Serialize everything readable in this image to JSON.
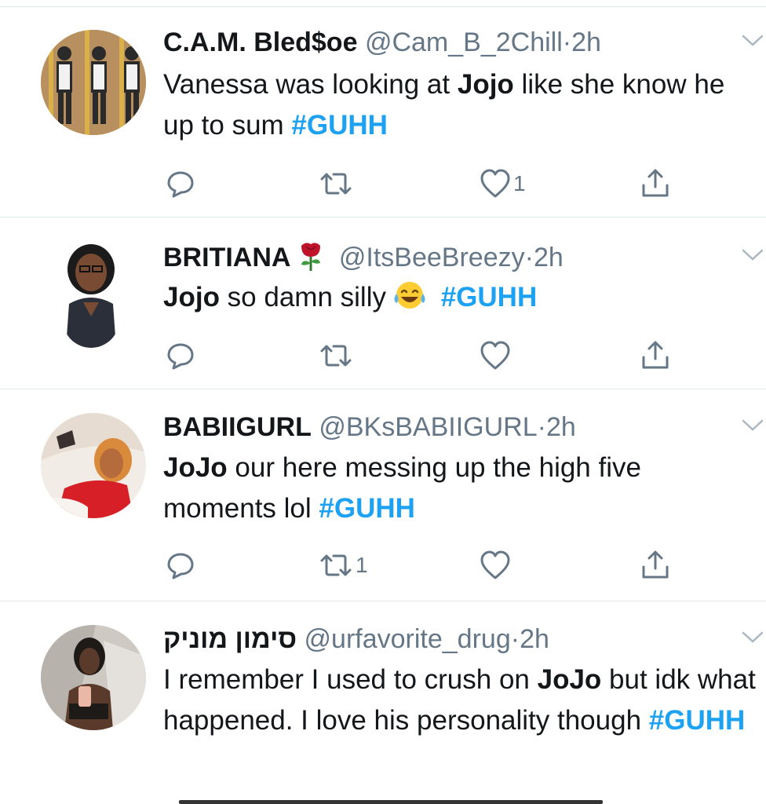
{
  "colors": {
    "accent": "#1da1f2",
    "secondary_text": "#657786",
    "divider": "#e1e8ed"
  },
  "tweets": [
    {
      "name": "C.A.M. Bled$oe",
      "handle": "@Cam_B_2Chill",
      "dot": "·",
      "time": "2h",
      "body": [
        {
          "text": "Vanessa was looking at ",
          "style": "plain"
        },
        {
          "text": "Jojo",
          "style": "bold"
        },
        {
          "text": " like she know he up to sum ",
          "style": "plain"
        },
        {
          "text": "#GUHH",
          "style": "hashtag"
        }
      ],
      "actions": {
        "reply_count": "",
        "retweet_count": "",
        "like_count": "1"
      }
    },
    {
      "name": "BRITIANA",
      "name_emoji": "rose-emoji",
      "handle": "@ItsBeeBreezy",
      "dot": "·",
      "time": "2h",
      "body": [
        {
          "text": "Jojo",
          "style": "bold"
        },
        {
          "text": " so damn silly",
          "style": "plain"
        },
        {
          "text": "",
          "style": "emoji-joy"
        },
        {
          "text": " #GUHH",
          "style": "hashtag"
        }
      ],
      "actions": {
        "reply_count": "",
        "retweet_count": "",
        "like_count": ""
      }
    },
    {
      "name": "BABIIGURL",
      "handle": "@BKsBABIIGURL",
      "dot": "·",
      "time": "2h",
      "body": [
        {
          "text": "JoJo",
          "style": "bold"
        },
        {
          "text": " our here messing up the high five moments lol ",
          "style": "plain"
        },
        {
          "text": "#GUHH",
          "style": "hashtag"
        }
      ],
      "actions": {
        "reply_count": "",
        "retweet_count": "1",
        "like_count": ""
      }
    },
    {
      "name": "סימון מוניק",
      "handle": "@urfavorite_drug",
      "dot": "·",
      "time": "2h",
      "body": [
        {
          "text": "I remember I used to crush on ",
          "style": "plain"
        },
        {
          "text": "JoJo",
          "style": "bold"
        },
        {
          "text": " but idk what happened. I love his personality though ",
          "style": "plain"
        },
        {
          "text": "#GUHH",
          "style": "hashtag"
        }
      ],
      "actions": null
    }
  ]
}
